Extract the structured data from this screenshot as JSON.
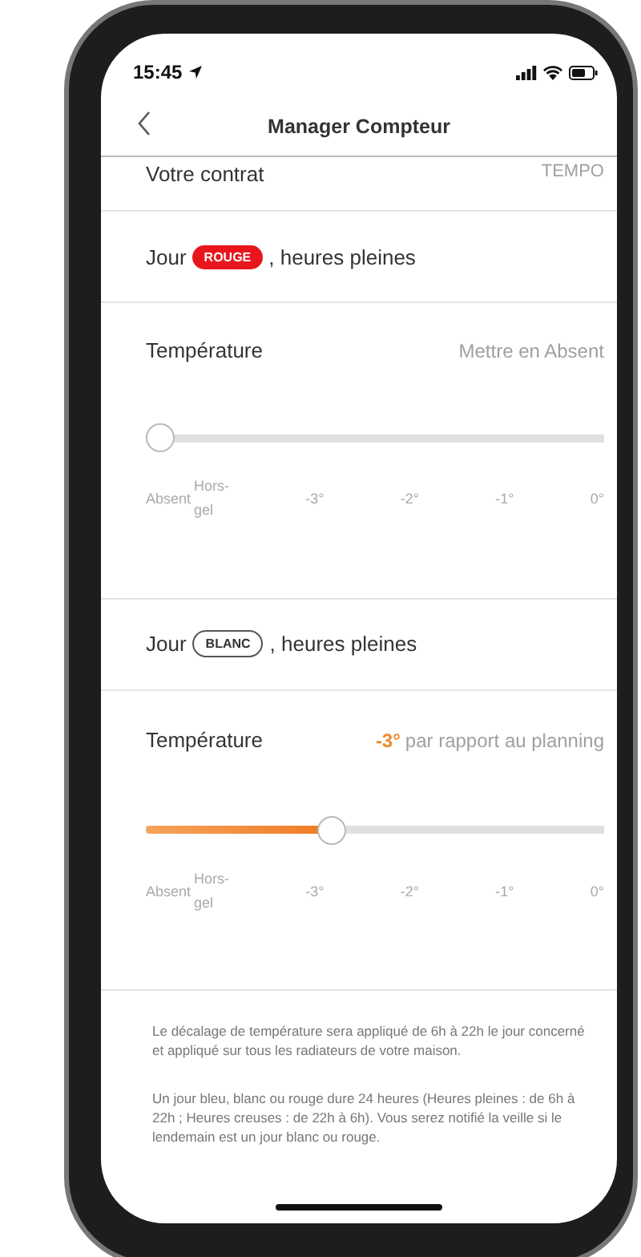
{
  "status_bar": {
    "time": "15:45"
  },
  "nav": {
    "title": "Manager Compteur"
  },
  "contract": {
    "label": "Votre contrat",
    "value": "TEMPO"
  },
  "days": [
    {
      "prefix": "Jour",
      "badge": {
        "kind": "rouge",
        "label": "ROUGE"
      },
      "suffix": ", heures pleines",
      "temperature": {
        "label": "Température",
        "right": {
          "kind": "action",
          "text": "Mettre en Absent"
        }
      },
      "slider": {
        "level": 0
      },
      "ticks": [
        "Absent",
        "Hors-gel",
        "-3°",
        "-2°",
        "-1°",
        "0°"
      ]
    },
    {
      "prefix": "Jour",
      "badge": {
        "kind": "blanc",
        "label": "BLANC"
      },
      "suffix": ", heures pleines",
      "temperature": {
        "label": "Température",
        "right": {
          "kind": "offset",
          "value": "-3°",
          "text": "par rapport au planning"
        }
      },
      "slider": {
        "level": 0.4
      },
      "ticks": [
        "Absent",
        "Hors-gel",
        "-3°",
        "-2°",
        "-1°",
        "0°"
      ]
    }
  ],
  "notes": [
    "Le décalage de température sera appliqué de 6h à 22h le jour concerné et appliqué sur tous les radiateurs de votre maison.",
    "Un jour bleu, blanc ou rouge dure 24 heures (Heures pleines : de 6h à 22h ; Heures creuses : de 22h à 6h). Vous serez notifié la veille si le lendemain est un jour blanc ou rouge."
  ]
}
